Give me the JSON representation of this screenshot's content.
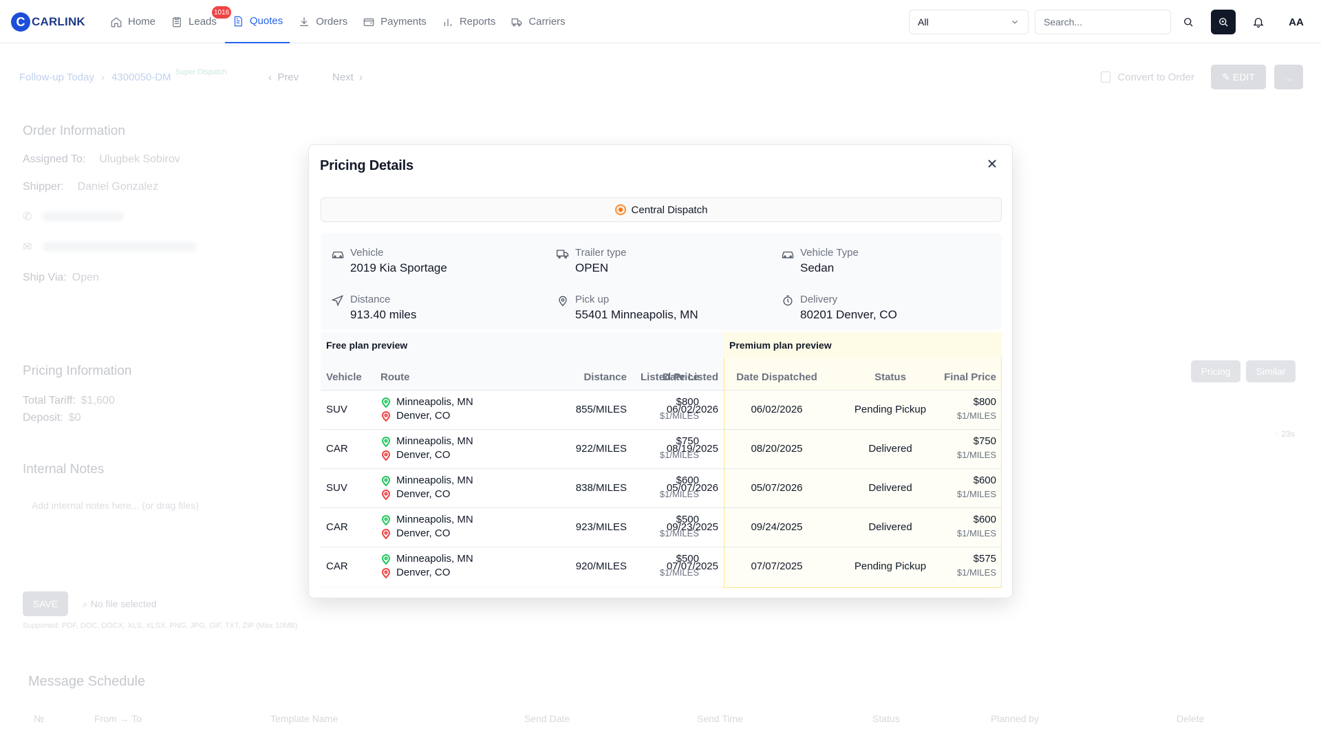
{
  "brand": {
    "name": "CARLINK",
    "mark": "C"
  },
  "nav": [
    {
      "label": "Home",
      "icon": "home-icon"
    },
    {
      "label": "Leads",
      "icon": "clipboard-icon",
      "badge": "1016"
    },
    {
      "label": "Quotes",
      "icon": "document-icon",
      "active": true
    },
    {
      "label": "Orders",
      "icon": "download-icon"
    },
    {
      "label": "Payments",
      "icon": "wallet-icon"
    },
    {
      "label": "Reports",
      "icon": "bar-chart-icon"
    },
    {
      "label": "Carriers",
      "icon": "truck-icon"
    }
  ],
  "header": {
    "filter_value": "All",
    "search_placeholder": "Search...",
    "avatar": "AA"
  },
  "breadcrumb": {
    "parent": "Follow-up Today",
    "current": "4300050-DM",
    "tag": "Super Dispatch",
    "prev": "Prev",
    "next": "Next"
  },
  "actions": {
    "convert": "Convert to Order",
    "edit": "EDIT",
    "more": "..."
  },
  "order_info": {
    "title": "Order Information",
    "assigned_label": "Assigned To:",
    "assigned_value": "Ulugbek Sobirov",
    "shipper_label": "Shipper:",
    "shipper_value": "Daniel Gonzalez",
    "ship_via_label": "Ship Via:",
    "ship_via_value": "Open"
  },
  "pricing_info": {
    "title": "Pricing Information",
    "tariff_label": "Total Tariff:",
    "tariff_value": "$1,600",
    "deposit_label": "Deposit:",
    "deposit_value": "$0",
    "pricing_btn": "Pricing",
    "similar_btn": "Similar",
    "timer": "23s"
  },
  "notes": {
    "title": "Internal Notes",
    "placeholder": "Add internal notes here... (or drag files)",
    "save": "SAVE",
    "no_file": "No file selected",
    "supported": "Supported: PDF, DOC, DOCX, XLS, XLSX, PNG, JPG, GIF, TXT, ZIP (Max 10MB)"
  },
  "messages": {
    "title": "Message Schedule",
    "columns": [
      "№",
      "From → To",
      "Template Name",
      "Send Date",
      "Send Time",
      "Status",
      "Planned by",
      "Delete"
    ]
  },
  "modal": {
    "title": "Pricing Details",
    "source": "Central Dispatch",
    "details": [
      {
        "label": "Vehicle",
        "value": "2019 Kia Sportage",
        "icon": "car-icon"
      },
      {
        "label": "Trailer type",
        "value": "OPEN",
        "icon": "trailer-icon"
      },
      {
        "label": "Vehicle Type",
        "value": "Sedan",
        "icon": "car-icon"
      },
      {
        "label": "Distance",
        "value": "913.40 miles",
        "icon": "navigation-icon"
      },
      {
        "label": "Pick up",
        "value": "55401 Minneapolis, MN",
        "icon": "map-pin-icon"
      },
      {
        "label": "Delivery",
        "value": "80201 Denver, CO",
        "icon": "timer-icon"
      }
    ],
    "free_title": "Free plan preview",
    "premium_title": "Premium plan preview",
    "columns": [
      "Vehicle",
      "Route",
      "Distance",
      "Listed Price",
      "Date Listed",
      "Date Dispatched",
      "Status",
      "Final Price"
    ],
    "rows": [
      {
        "vehicle": "SUV",
        "from": "Minneapolis, MN",
        "to": "Denver, CO",
        "distance": "855/MILES",
        "listed": "$800",
        "listed_rate": "$1/MILES",
        "date_listed": "06/02/2026",
        "date_dispatched": "06/02/2026",
        "status": "Pending Pickup",
        "final": "$800",
        "final_rate": "$1/MILES"
      },
      {
        "vehicle": "CAR",
        "from": "Minneapolis, MN",
        "to": "Denver, CO",
        "distance": "922/MILES",
        "listed": "$750",
        "listed_rate": "$1/MILES",
        "date_listed": "08/19/2025",
        "date_dispatched": "08/20/2025",
        "status": "Delivered",
        "final": "$750",
        "final_rate": "$1/MILES"
      },
      {
        "vehicle": "SUV",
        "from": "Minneapolis, MN",
        "to": "Denver, CO",
        "distance": "838/MILES",
        "listed": "$600",
        "listed_rate": "$1/MILES",
        "date_listed": "05/07/2026",
        "date_dispatched": "05/07/2026",
        "status": "Delivered",
        "final": "$600",
        "final_rate": "$1/MILES"
      },
      {
        "vehicle": "CAR",
        "from": "Minneapolis, MN",
        "to": "Denver, CO",
        "distance": "923/MILES",
        "listed": "$500",
        "listed_rate": "$1/MILES",
        "date_listed": "09/23/2025",
        "date_dispatched": "09/24/2025",
        "status": "Delivered",
        "final": "$600",
        "final_rate": "$1/MILES"
      },
      {
        "vehicle": "CAR",
        "from": "Minneapolis, MN",
        "to": "Denver, CO",
        "distance": "920/MILES",
        "listed": "$500",
        "listed_rate": "$1/MILES",
        "date_listed": "07/07/2025",
        "date_dispatched": "07/07/2025",
        "status": "Pending Pickup",
        "final": "$575",
        "final_rate": "$1/MILES"
      }
    ]
  },
  "colors": {
    "accent": "#2563eb",
    "badge": "#ef4444",
    "pickup_pin": "#22c55e",
    "delivery_pin": "#ef4444",
    "premium_bg": "#fffdf0"
  }
}
